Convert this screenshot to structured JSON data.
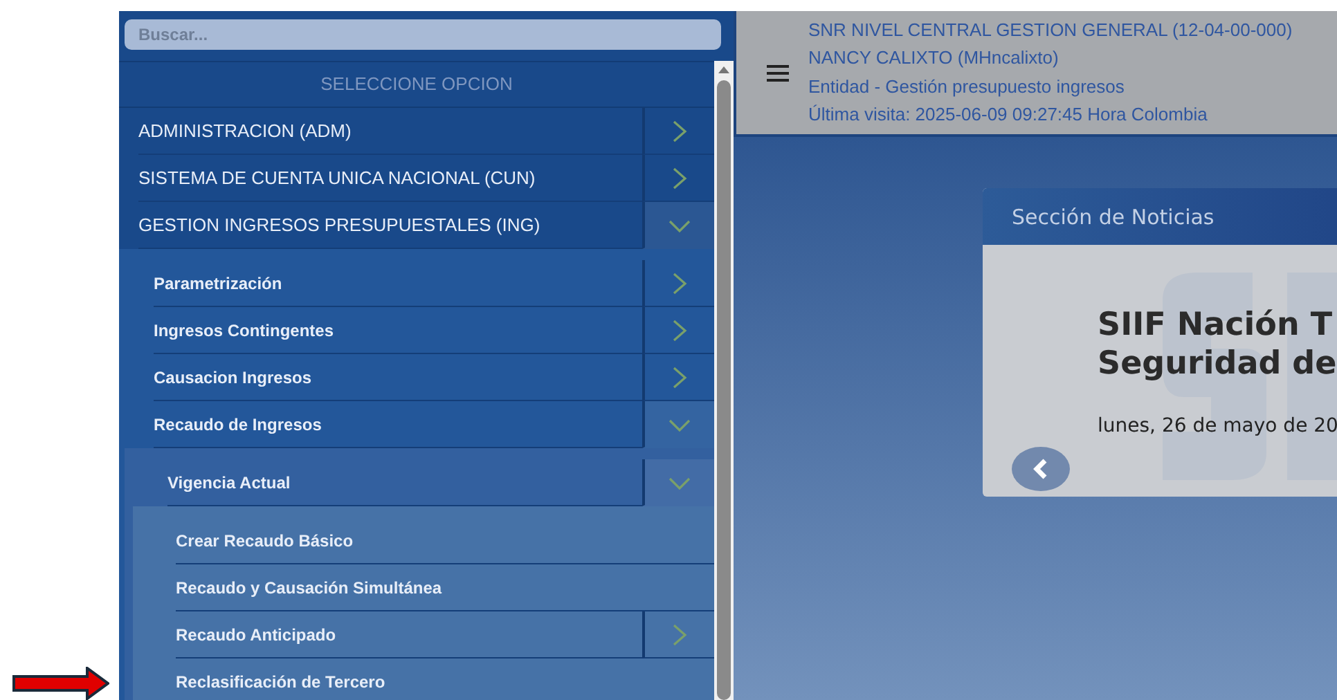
{
  "sidebar": {
    "search": {
      "placeholder": "Buscar..."
    },
    "heading": "SELECCIONE OPCION",
    "items": [
      {
        "label": "ADMINISTRACION (ADM)",
        "kind": "group",
        "expanded": false
      },
      {
        "label": "SISTEMA DE CUENTA UNICA NACIONAL (CUN)",
        "kind": "group",
        "expanded": false
      },
      {
        "label": "GESTION INGRESOS PRESUPUESTALES (ING)",
        "kind": "group",
        "expanded": true,
        "children": [
          {
            "label": "Parametrización",
            "kind": "group",
            "expanded": false
          },
          {
            "label": "Ingresos Contingentes",
            "kind": "group",
            "expanded": false
          },
          {
            "label": "Causacion Ingresos",
            "kind": "group",
            "expanded": false
          },
          {
            "label": "Recaudo de Ingresos",
            "kind": "group",
            "expanded": true,
            "children": [
              {
                "label": "Vigencia Actual",
                "kind": "group",
                "expanded": true,
                "children": [
                  {
                    "label": "Crear Recaudo Básico",
                    "kind": "link"
                  },
                  {
                    "label": "Recaudo y Causación Simultánea",
                    "kind": "link"
                  },
                  {
                    "label": "Recaudo Anticipado",
                    "kind": "group",
                    "expanded": false
                  },
                  {
                    "label": "Reclasificación de Tercero",
                    "kind": "link"
                  }
                ]
              }
            ]
          }
        ]
      }
    ]
  },
  "header": {
    "lines": [
      "SNR NIVEL CENTRAL GESTION GENERAL (12-04-00-000)",
      "NANCY CALIXTO (MHncalixto)",
      "Entidad - Gestión presupuesto ingresos",
      "Última visita: 2025-06-09 09:27:45 Hora Colombia"
    ]
  },
  "news": {
    "title": "Sección de Noticias",
    "headline": [
      "SIIF Nación T",
      "Seguridad de"
    ],
    "date": "lunes, 26 de mayo de 20"
  }
}
